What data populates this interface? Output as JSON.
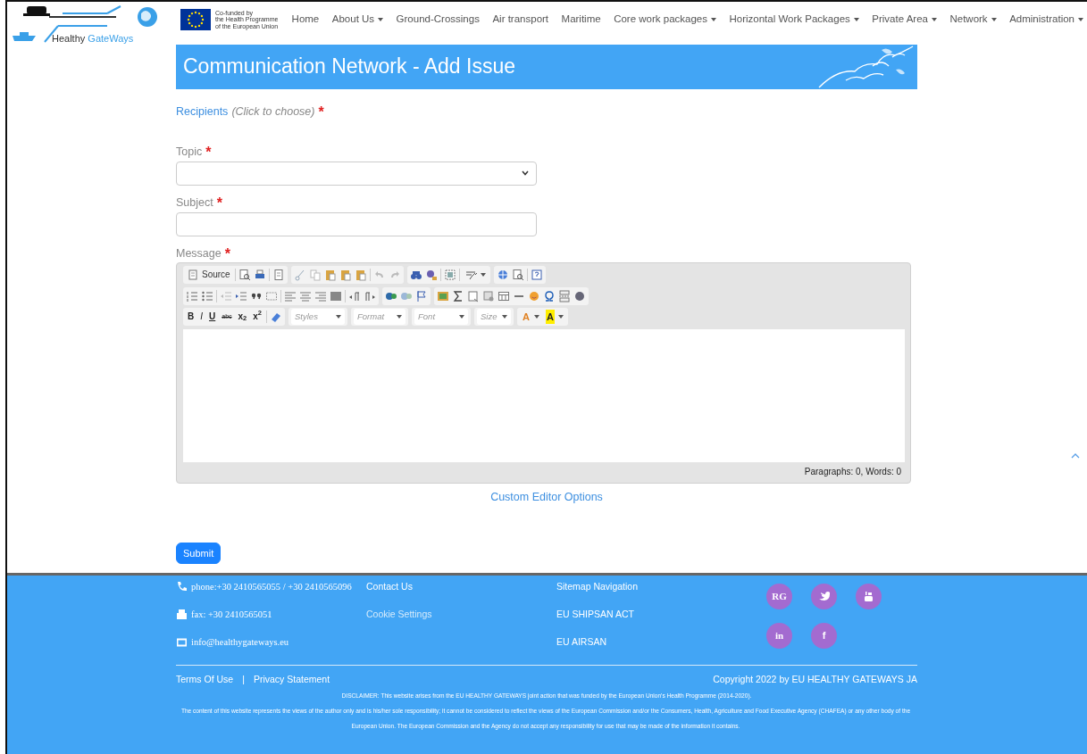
{
  "logo": {
    "text": "Healthy",
    "text_accent": "GateWays"
  },
  "eu_logo": {
    "lines": [
      "Co-funded by",
      "the Health Programme",
      "of the European Union"
    ]
  },
  "nav": [
    {
      "label": "Home",
      "dropdown": false
    },
    {
      "label": "About Us",
      "dropdown": true
    },
    {
      "label": "Ground-Crossings",
      "dropdown": false
    },
    {
      "label": "Air transport",
      "dropdown": false
    },
    {
      "label": "Maritime",
      "dropdown": false
    },
    {
      "label": "Core work packages",
      "dropdown": true
    },
    {
      "label": "Horizontal Work Packages",
      "dropdown": true
    },
    {
      "label": "Private Area",
      "dropdown": true
    },
    {
      "label": "Network",
      "dropdown": true
    },
    {
      "label": "Administration",
      "dropdown": true
    }
  ],
  "banner": {
    "title": "Communication Network - Add Issue"
  },
  "form": {
    "required_mark": "*",
    "recipients": {
      "link": "Recipients",
      "hint": "(Click to choose)",
      "required": true
    },
    "fields": [
      {
        "kind": "select",
        "label": "Topic",
        "required": true
      },
      {
        "kind": "text",
        "label": "Subject",
        "required": true
      }
    ],
    "message": {
      "label": "Message",
      "required": true
    },
    "editor": {
      "source_label": "Source",
      "format_buttons": [
        "B",
        "I",
        "U",
        "abc",
        "x$_{2}$",
        "x$^{2}$"
      ],
      "combos": [
        "Styles",
        "Format",
        "Font",
        "Size"
      ],
      "color_buttons": [
        "A",
        "A"
      ],
      "status": "Paragraphs: 0, Words: 0"
    },
    "custom_options": "Custom Editor Options",
    "submit": "Submit"
  },
  "footer": {
    "contacts": [
      {
        "kind": "phone",
        "text": "phone:+30 2410565055 / +30 2410565096"
      },
      {
        "kind": "fax",
        "text": "fax: +30 2410565051"
      },
      {
        "kind": "email",
        "text": "info@healthygateways.eu"
      }
    ],
    "links": [
      {
        "label": "Contact Us",
        "muted": false
      },
      {
        "label": "Cookie Settings",
        "muted": true
      }
    ],
    "sitemap": [
      "Sitemap Navigation",
      "EU SHIPSAN ACT",
      "EU AIRSAN"
    ],
    "social": [
      {
        "kind": "text",
        "label": "RG"
      },
      {
        "kind": "twitter"
      },
      {
        "kind": "youtube"
      },
      {
        "kind": "text",
        "label": "in"
      },
      {
        "kind": "text",
        "label": "f"
      }
    ],
    "bottom_links": [
      "Terms Of Use",
      "Privacy Statement"
    ],
    "separator": "|",
    "copyright": "Copyright 2022 by EU HEALTHY GATEWAYS JA",
    "disclaimer": "DISCLAIMER: This website arises from the EU HEALTHY GATEWAYS joint action that was funded by the European Union's Health Programme (2014-2020).",
    "content_note": "The content of this website represents the views of the author only and is his/her sole responsibility; it cannot be considered to reflect the views of the European Commission and/or the Consumers, Health, Agriculture and Food Executive Agency (CHAFEA) or any other body of the European Union. The European Commission and the Agency do not accept any responsibility for use that may be made of the information it contains."
  }
}
